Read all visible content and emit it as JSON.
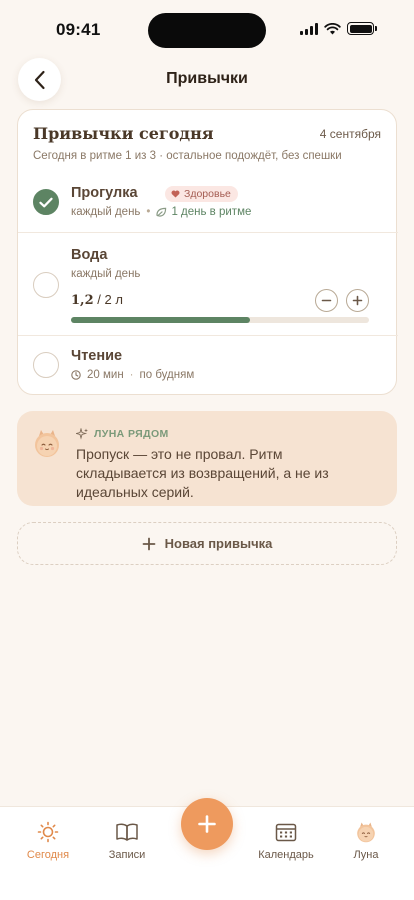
{
  "status_bar": {
    "time": "09:41"
  },
  "header": {
    "title": "Привычки"
  },
  "today_card": {
    "title": "Привычки сегодня",
    "date": "4 сентября",
    "subtitle": "Сегодня в ритме 1 из 3 · остальное подождёт, без спешки"
  },
  "habits": [
    {
      "name": "Прогулка",
      "done": true,
      "tag": "Здоровье",
      "frequency": "каждый день",
      "streak": "1 день в ритме"
    },
    {
      "name": "Вода",
      "done": false,
      "frequency": "каждый день",
      "amount_current": "1,2",
      "amount_goal": "/ 2 л",
      "progress": 0.6
    },
    {
      "name": "Чтение",
      "done": false,
      "duration": "20 мин",
      "schedule": "по будням"
    }
  ],
  "luna_note": {
    "label": "ЛУНА РЯДОМ",
    "text": "Пропуск — это не провал. Ритм складывается из возвращений, а не из идеальных серий."
  },
  "new_habit": {
    "label": "Новая привычка"
  },
  "tabs": [
    {
      "label": "Сегодня",
      "icon": "sun-icon",
      "active": true
    },
    {
      "label": "Записи",
      "icon": "book-icon",
      "active": false
    },
    {
      "label": "Календарь",
      "icon": "calendar-icon",
      "active": false
    },
    {
      "label": "Луна",
      "icon": "luna-icon",
      "active": false
    }
  ],
  "colors": {
    "background": "#fbf6f1",
    "accent_orange": "#ee9a5e",
    "green": "#5d8463",
    "luna_card": "#f6e3d2"
  }
}
